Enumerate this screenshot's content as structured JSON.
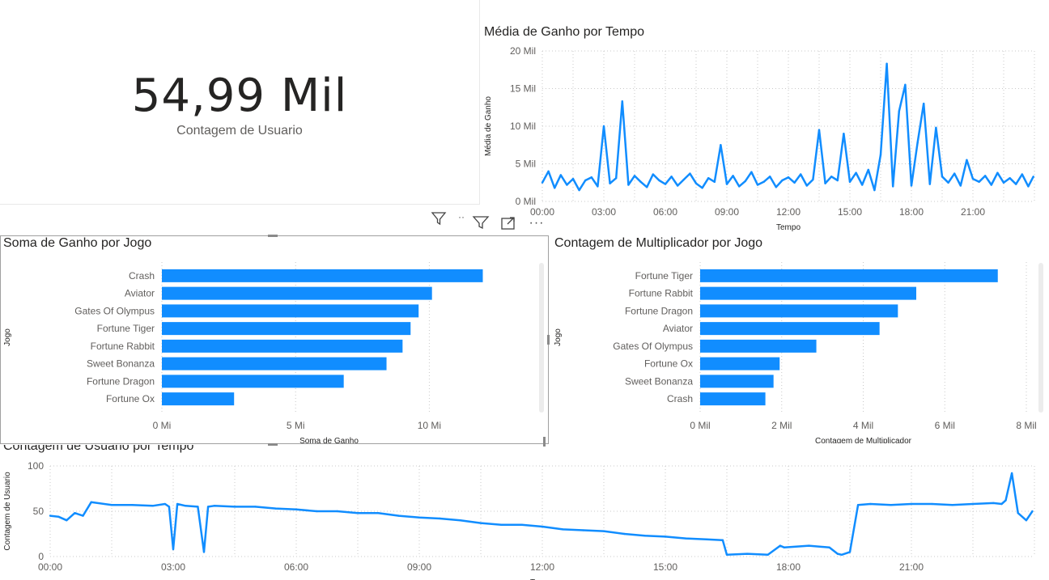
{
  "kpi": {
    "value": "54,99 Mil",
    "label": "Contagem de Usuario"
  },
  "visual_header": {
    "icons": [
      "filter-icon",
      "focus-mode-icon",
      "more-options-icon"
    ]
  },
  "colors": {
    "series": "#118dff",
    "grid": "#c8c8c8",
    "text": "#605e5c",
    "title": "#252423"
  },
  "chart_data": [
    {
      "id": "media-ganho",
      "type": "line",
      "title": "Média de Ganho por Tempo",
      "xlabel": "Tempo",
      "ylabel": "Média de Ganho",
      "x_ticks": [
        "00:00",
        "03:00",
        "06:00",
        "09:00",
        "12:00",
        "15:00",
        "18:00",
        "21:00"
      ],
      "y_ticks": [
        "0 Mil",
        "5 Mil",
        "10 Mil",
        "15 Mil",
        "20 Mil"
      ],
      "ylim": [
        0,
        20000
      ],
      "xlim_hours": [
        0,
        24
      ],
      "series": [
        {
          "x_hours": [
            0.0,
            0.3,
            0.6,
            0.9,
            1.2,
            1.5,
            1.8,
            2.1,
            2.4,
            2.7,
            3.0,
            3.3,
            3.6,
            3.9,
            4.2,
            4.5,
            4.8,
            5.1,
            5.4,
            5.7,
            6.0,
            6.3,
            6.6,
            6.9,
            7.2,
            7.5,
            7.8,
            8.1,
            8.4,
            8.7,
            9.0,
            9.3,
            9.6,
            9.9,
            10.2,
            10.5,
            10.8,
            11.1,
            11.4,
            11.7,
            12.0,
            12.3,
            12.6,
            12.9,
            13.2,
            13.5,
            13.8,
            14.1,
            14.4,
            14.7,
            15.0,
            15.3,
            15.6,
            15.9,
            16.2,
            16.5,
            16.8,
            17.1,
            17.4,
            17.7,
            18.0,
            18.3,
            18.6,
            18.9,
            19.2,
            19.5,
            19.8,
            20.1,
            20.4,
            20.7,
            21.0,
            21.3,
            21.6,
            21.9,
            22.2,
            22.5,
            22.8,
            23.1,
            23.4,
            23.7,
            23.95
          ],
          "values": [
            2500,
            4000,
            1800,
            3500,
            2200,
            3000,
            1500,
            2800,
            3200,
            2000,
            10000,
            2400,
            3100,
            13300,
            2200,
            3400,
            2600,
            1900,
            3600,
            2800,
            2300,
            3300,
            2100,
            2900,
            3700,
            2400,
            1800,
            3100,
            2600,
            7500,
            2300,
            3400,
            2000,
            2700,
            3900,
            2200,
            2600,
            3300,
            1900,
            2800,
            3200,
            2500,
            3600,
            2100,
            2900,
            9500,
            2400,
            3300,
            2800,
            9000,
            2600,
            3800,
            2200,
            4200,
            1500,
            6200,
            18300,
            2000,
            12000,
            15500,
            2100,
            7800,
            13000,
            2300,
            9800,
            3300,
            2500,
            3700,
            2100,
            5500,
            3000,
            2600,
            3400,
            2200,
            3800,
            2500,
            3100,
            2300,
            3600,
            2000,
            3300
          ]
        }
      ]
    },
    {
      "id": "soma-ganho",
      "type": "bar",
      "orientation": "horizontal",
      "title": "Soma de Ganho por Jogo",
      "xlabel": "Soma de Ganho",
      "ylabel": "Jogo",
      "categories": [
        "Crash",
        "Aviator",
        "Gates Of Olympus",
        "Fortune Tiger",
        "Fortune Rabbit",
        "Sweet Bonanza",
        "Fortune Dragon",
        "Fortune Ox"
      ],
      "values": [
        12000000,
        10100000,
        9600000,
        9300000,
        9000000,
        8400000,
        6800000,
        2700000
      ],
      "x_ticks": [
        "0 Mi",
        "5 Mi",
        "10 Mi"
      ],
      "xlim": [
        0,
        12500000
      ]
    },
    {
      "id": "contagem-multiplicador",
      "type": "bar",
      "orientation": "horizontal",
      "title": "Contagem de Multiplicador por Jogo",
      "xlabel": "Contagem de Multiplicador",
      "ylabel": "Jogo",
      "categories": [
        "Fortune Tiger",
        "Fortune Rabbit",
        "Fortune Dragon",
        "Aviator",
        "Gates Of Olympus",
        "Fortune Ox",
        "Sweet Bonanza",
        "Crash"
      ],
      "values": [
        7300,
        5300,
        4850,
        4400,
        2850,
        1950,
        1800,
        1600
      ],
      "x_ticks": [
        "0 Mil",
        "2 Mil",
        "4 Mil",
        "6 Mil",
        "8 Mil"
      ],
      "xlim": [
        0,
        8000
      ]
    },
    {
      "id": "contagem-usuario",
      "type": "line",
      "title": "Contagem de Usuario por Tempo",
      "xlabel": "Tempo",
      "ylabel": "Contagem de Usuario",
      "x_ticks": [
        "00:00",
        "03:00",
        "06:00",
        "09:00",
        "12:00",
        "15:00",
        "18:00",
        "21:00"
      ],
      "y_ticks": [
        "0",
        "50",
        "100"
      ],
      "ylim": [
        0,
        100
      ],
      "xlim_hours": [
        0,
        24
      ],
      "series": [
        {
          "x_hours": [
            0.0,
            0.2,
            0.4,
            0.6,
            0.8,
            1.0,
            1.5,
            2.0,
            2.5,
            2.8,
            2.9,
            3.0,
            3.1,
            3.3,
            3.6,
            3.75,
            3.85,
            4.0,
            4.5,
            5.0,
            5.5,
            6.0,
            6.5,
            7.0,
            7.5,
            8.0,
            8.5,
            9.0,
            9.5,
            10.0,
            10.5,
            11.0,
            11.5,
            12.0,
            12.5,
            13.0,
            13.5,
            14.0,
            14.5,
            15.0,
            15.5,
            16.0,
            16.4,
            16.5,
            17.0,
            17.5,
            17.8,
            17.9,
            18.5,
            19.0,
            19.2,
            19.3,
            19.5,
            19.7,
            20.0,
            20.5,
            21.0,
            21.5,
            22.0,
            22.5,
            23.0,
            23.2,
            23.3,
            23.45,
            23.6,
            23.8,
            23.95
          ],
          "values": [
            45,
            44,
            40,
            48,
            45,
            60,
            57,
            57,
            56,
            58,
            55,
            8,
            58,
            56,
            55,
            5,
            55,
            56,
            55,
            55,
            53,
            52,
            50,
            50,
            48,
            48,
            45,
            43,
            42,
            40,
            37,
            35,
            35,
            33,
            30,
            29,
            28,
            25,
            23,
            22,
            20,
            19,
            18,
            2,
            3,
            2,
            12,
            10,
            12,
            10,
            3,
            2,
            5,
            57,
            58,
            57,
            58,
            58,
            57,
            58,
            59,
            58,
            62,
            92,
            48,
            40,
            50
          ]
        }
      ]
    }
  ]
}
